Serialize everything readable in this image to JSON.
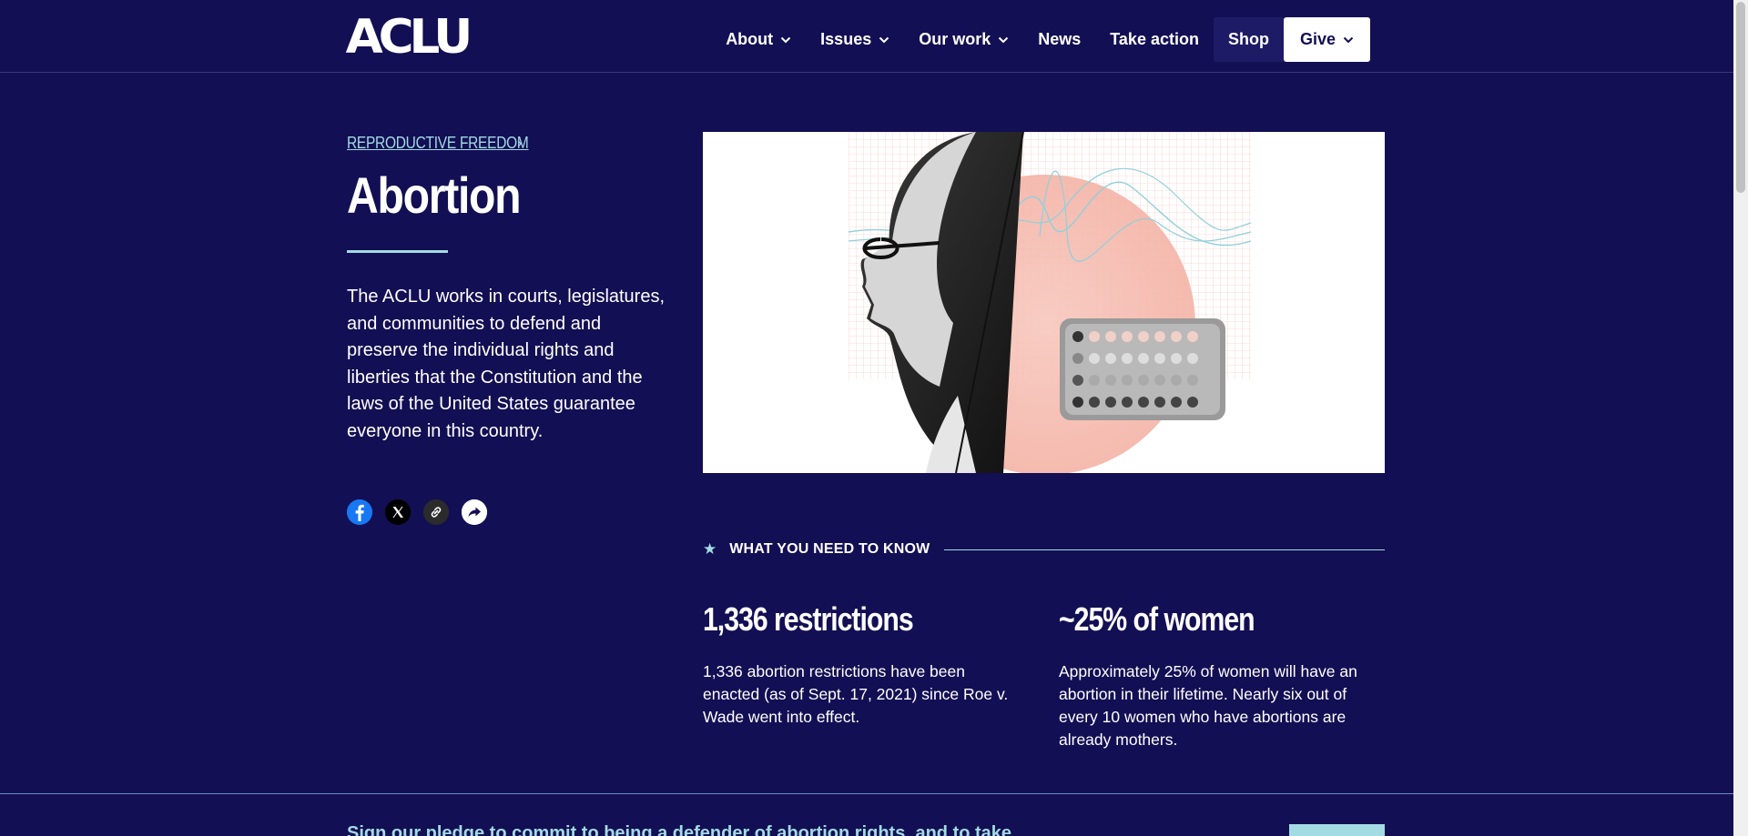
{
  "header": {
    "logo": "ACLU",
    "nav": [
      {
        "label": "About",
        "has_dropdown": true
      },
      {
        "label": "Issues",
        "has_dropdown": true
      },
      {
        "label": "Our work",
        "has_dropdown": true
      },
      {
        "label": "News",
        "has_dropdown": false
      },
      {
        "label": "Take action",
        "has_dropdown": false
      },
      {
        "label": "Shop",
        "has_dropdown": false
      },
      {
        "label": "Give",
        "has_dropdown": true
      }
    ]
  },
  "breadcrumb": {
    "label": "REPRODUCTIVE FREEDOM",
    "separator": "›"
  },
  "page": {
    "title": "Abortion",
    "intro": "The ACLU works in courts, legislatures, and communities to defend and preserve the individual rights and liberties that the Constitution and the laws of the United States guarantee everyone in this country."
  },
  "share": [
    {
      "icon": "facebook-icon"
    },
    {
      "icon": "x-twitter-icon"
    },
    {
      "icon": "link-icon"
    },
    {
      "icon": "share-arrow-icon"
    }
  ],
  "know": {
    "label": "WHAT YOU NEED TO KNOW"
  },
  "stats": [
    {
      "headline": "1,336 restrictions",
      "body": "1,336 abortion restrictions have been enacted (as of Sept. 17, 2021) since Roe v. Wade went into effect."
    },
    {
      "headline": "~25% of women",
      "body": "Approximately 25% of women will have an abortion in their lifetime. Nearly six out of every 10 women who have abortions are already mothers."
    }
  ],
  "pledge": {
    "text": "Sign our pledge to commit to being a defender of abortion rights, and to take"
  },
  "colors": {
    "background": "#130f54",
    "accent": "#a3dbe3",
    "white": "#ffffff"
  }
}
